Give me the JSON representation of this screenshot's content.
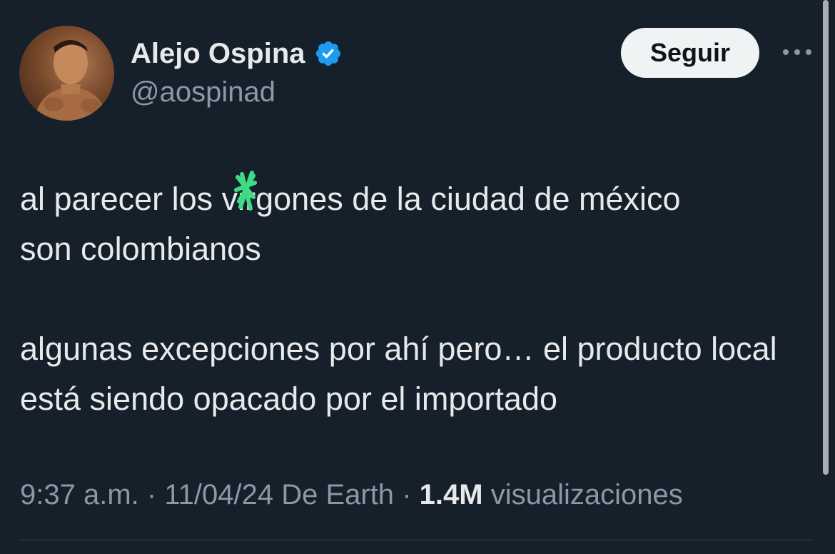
{
  "author": {
    "display_name": "Alejo Ospina",
    "handle": "@aospinad",
    "verified": true
  },
  "follow_label": "Seguir",
  "more_icon": "more-horizontal-icon",
  "tweet": {
    "line1_before": "al parecer los v",
    "line1_obscured": "i",
    "line1_after": "rgones de la ciudad de méxico",
    "line2": "son colombianos",
    "paragraph2": "algunas excepciones por ahí pero… el producto local está siendo opacado por el importado"
  },
  "meta": {
    "time": "9:37 a.m.",
    "separator1": "·",
    "date": "11/04/24",
    "source": "De Earth",
    "separator2": "·",
    "views_count": "1.4M",
    "views_label": "visualizaciones"
  },
  "colors": {
    "background": "#15202b",
    "text": "#e7e9ea",
    "secondary_text": "#8b98a5",
    "verified_blue": "#1d9bf0",
    "scribble_green": "#3ddc84",
    "button_bg": "#eff3f4"
  }
}
